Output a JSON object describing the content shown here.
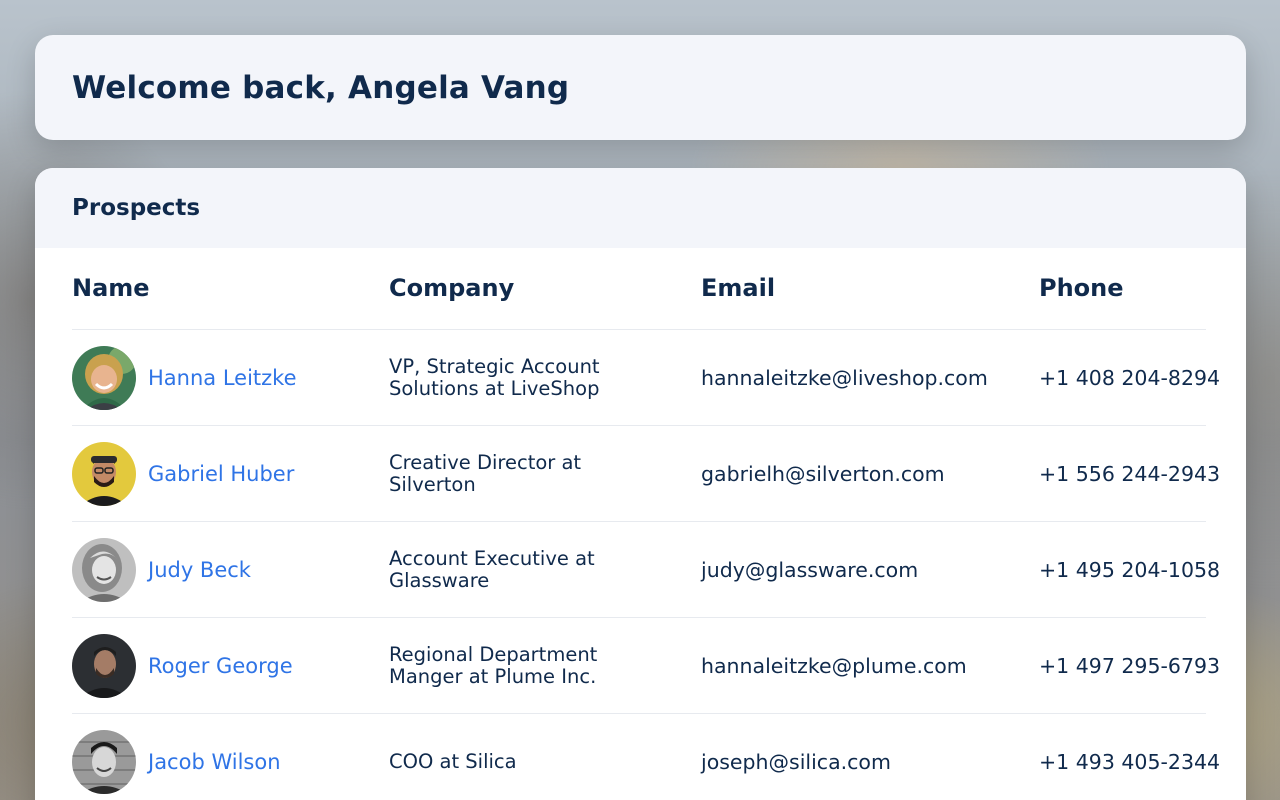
{
  "welcome": {
    "title": "Welcome back, Angela Vang"
  },
  "prospects": {
    "title": "Prospects",
    "columns": {
      "name": "Name",
      "company": "Company",
      "email": "Email",
      "phone": "Phone"
    },
    "rows": [
      {
        "name": "Hanna Leitzke",
        "company": "VP, Strategic Account Solutions at LiveShop",
        "email": "hannaleitzke@liveshop.com",
        "phone": "+1 408 204-8294"
      },
      {
        "name": "Gabriel Huber",
        "company": "Creative Director at Silverton",
        "email": "gabrielh@silverton.com",
        "phone": "+1 556 244-2943"
      },
      {
        "name": "Judy Beck",
        "company": "Account Executive at Glassware",
        "email": "judy@glassware.com",
        "phone": "+1 495 204-1058"
      },
      {
        "name": "Roger George",
        "company": "Regional Department Manger at Plume Inc.",
        "email": "hannaleitzke@plume.com",
        "phone": "+1 497 295-6793"
      },
      {
        "name": "Jacob Wilson",
        "company": "COO at Silica",
        "email": "joseph@silica.com",
        "phone": "+1 493 405-2344"
      }
    ]
  },
  "colors": {
    "heading": "#102a4c",
    "link": "#2f74e6",
    "card_header_bg": "#f3f5fa"
  }
}
